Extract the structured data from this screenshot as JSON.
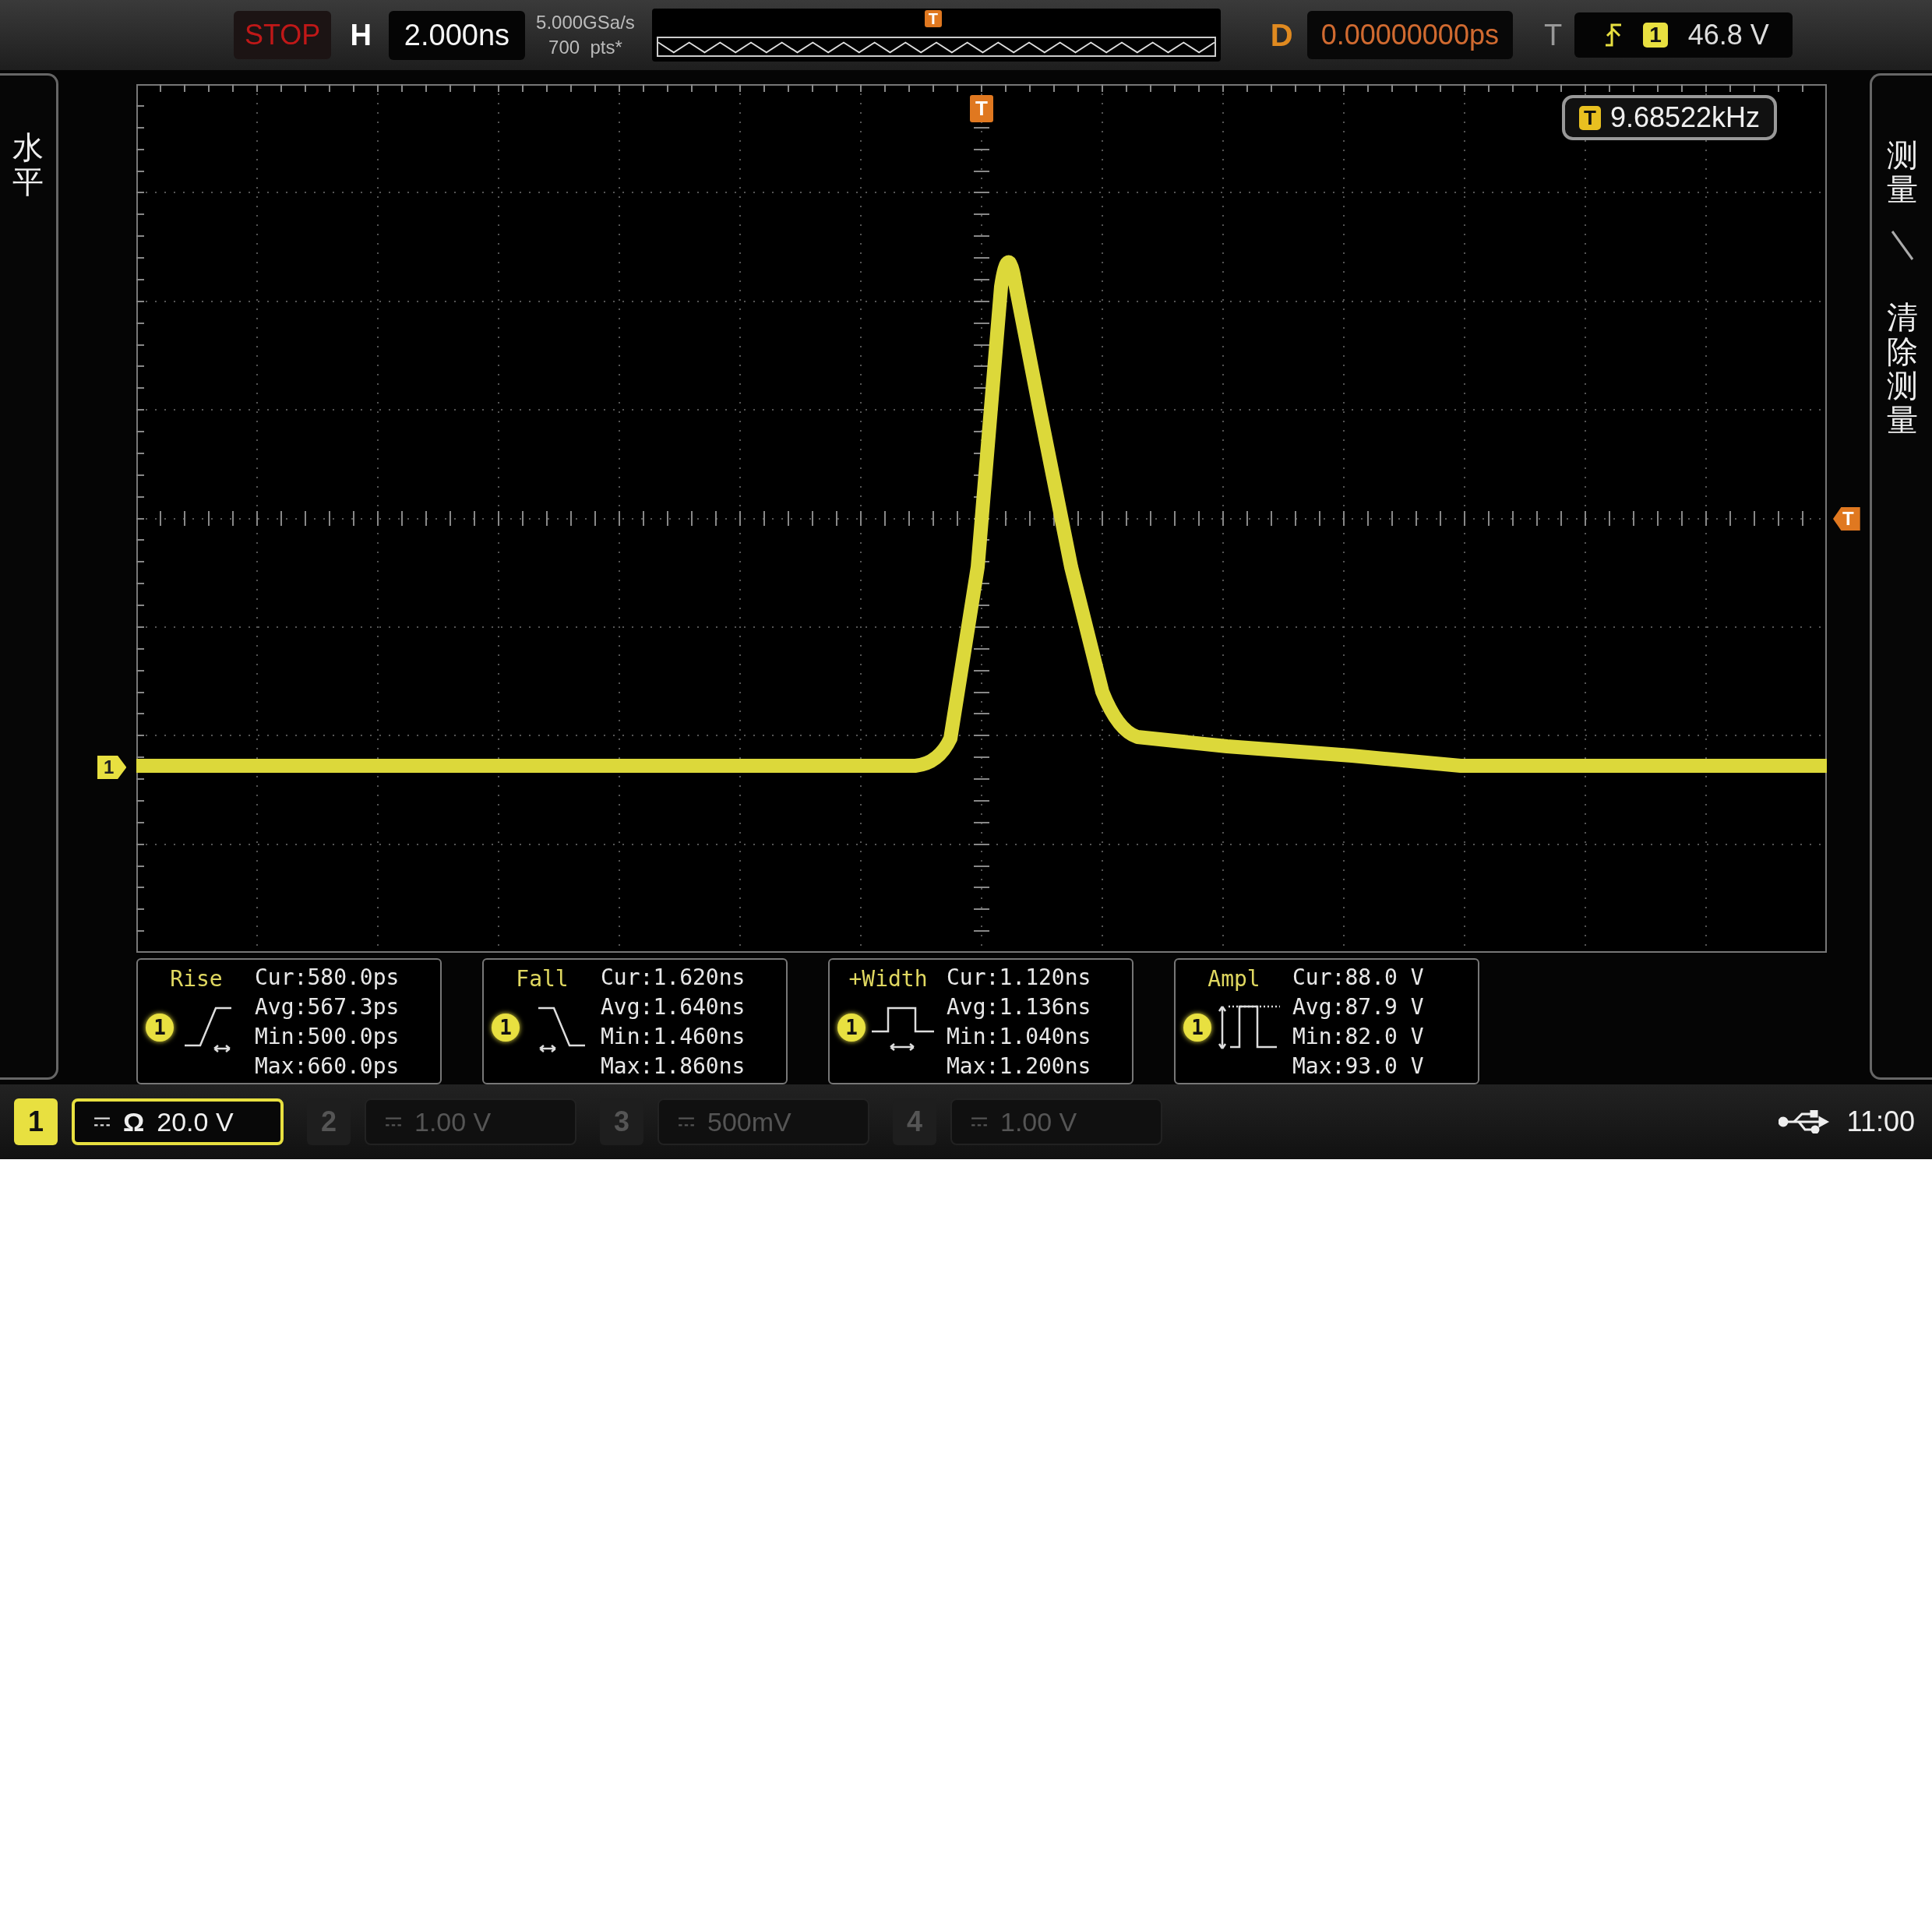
{
  "top_bar": {
    "run_state": "STOP",
    "timebase_label": "H",
    "timebase": "2.000ns",
    "sample_rate": "5.000GSa/s",
    "memory_depth": "700  pts*",
    "overview_marker": "T",
    "delay_label": "D",
    "delay": "0.00000000ps",
    "trigger_label": "T",
    "trigger_source": "1",
    "trigger_level": "46.8 V"
  },
  "left_menu": {
    "label": "水平"
  },
  "right_menu": {
    "items": [
      {
        "label": "测量"
      },
      {
        "label": "清除测量"
      }
    ]
  },
  "display": {
    "trigger_position_marker": "T",
    "trigger_level_marker": "T",
    "channel_marker": "1",
    "frequency": {
      "source": "T",
      "value": "9.68522kHz"
    }
  },
  "measurements": [
    {
      "kind": "rise",
      "name": "Rise",
      "source": "1",
      "lines": [
        "Cur:580.0ps",
        "Avg:567.3ps",
        "Min:500.0ps",
        "Max:660.0ps"
      ]
    },
    {
      "kind": "fall",
      "name": "Fall",
      "source": "1",
      "lines": [
        "Cur:1.620ns",
        "Avg:1.640ns",
        "Min:1.460ns",
        "Max:1.860ns"
      ]
    },
    {
      "kind": "width",
      "name": "+Width",
      "source": "1",
      "lines": [
        "Cur:1.120ns",
        "Avg:1.136ns",
        "Min:1.040ns",
        "Max:1.200ns"
      ]
    },
    {
      "kind": "ampl",
      "name": "Ampl",
      "source": "1",
      "lines": [
        "Cur:88.0 V",
        "Avg:87.9 V",
        "Min:82.0 V",
        "Max:93.0 V"
      ]
    }
  ],
  "channels": [
    {
      "number": "1",
      "impedance": "Ω",
      "scale": "20.0 V",
      "on": true
    },
    {
      "number": "2",
      "scale": "1.00 V",
      "on": false
    },
    {
      "number": "3",
      "scale": "500mV",
      "on": false
    },
    {
      "number": "4",
      "scale": "1.00 V",
      "on": false
    }
  ],
  "status_bar": {
    "time": "11:00"
  }
}
